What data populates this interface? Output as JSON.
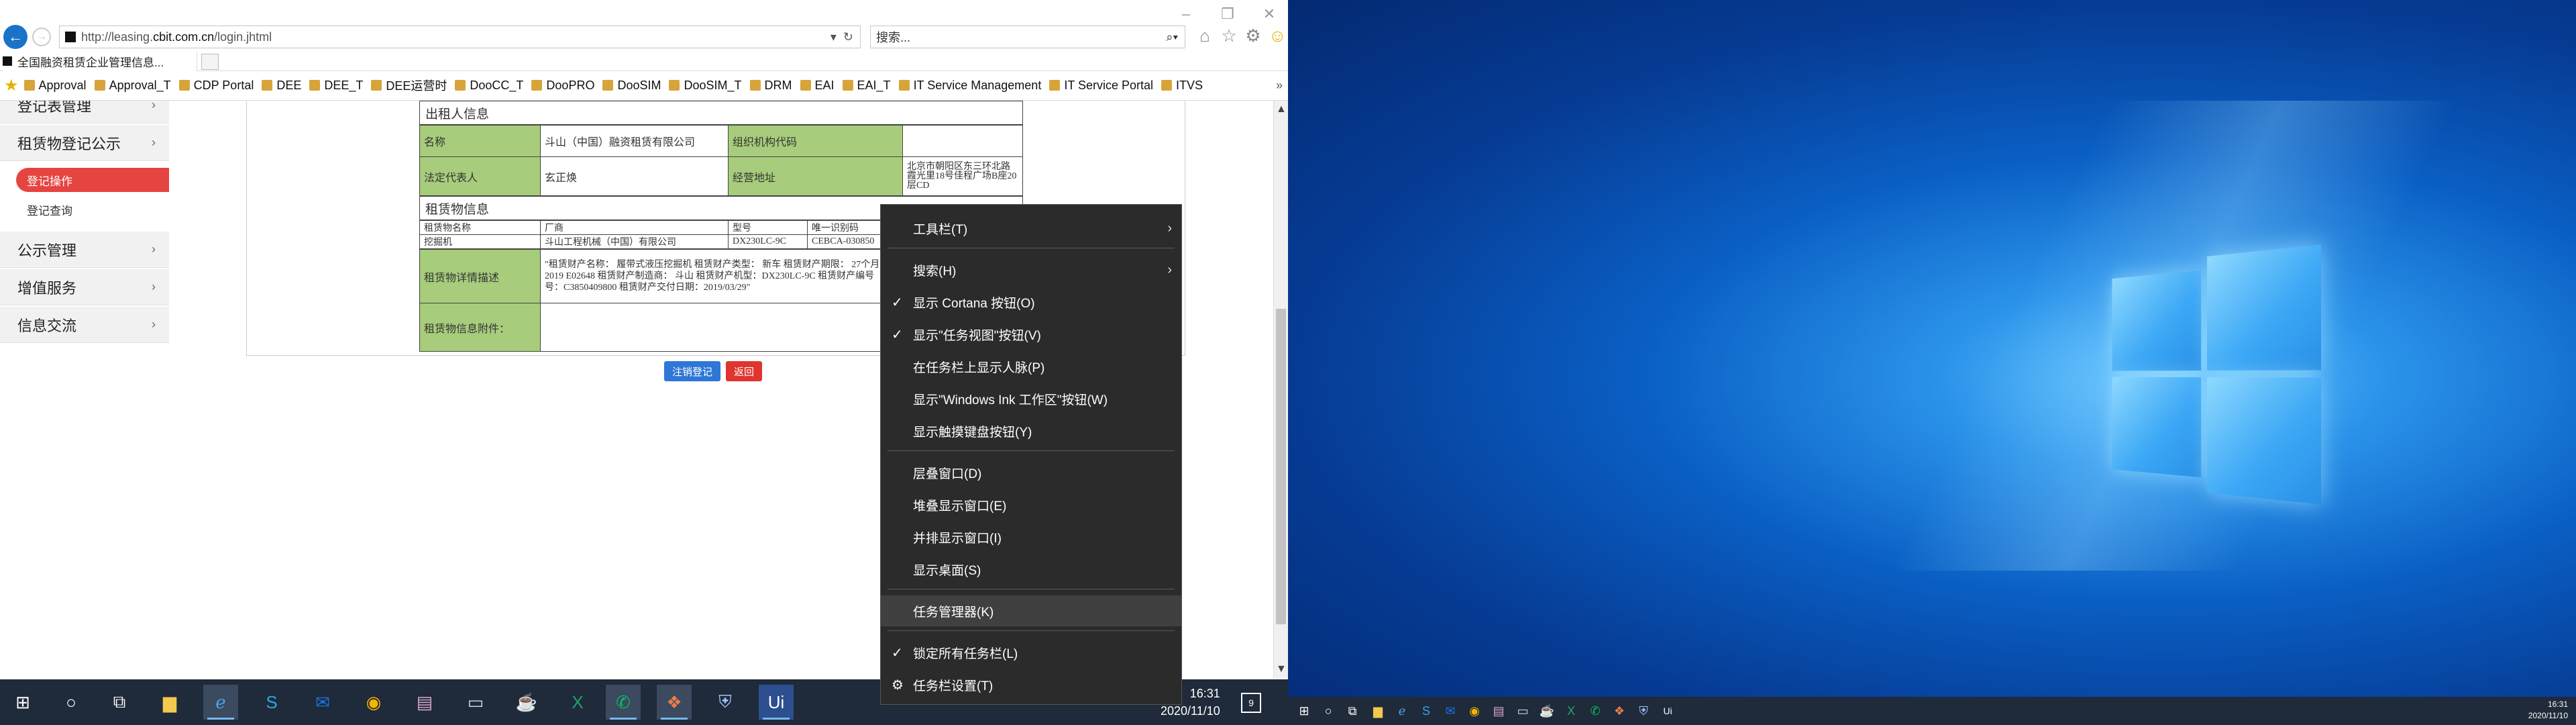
{
  "browser": {
    "address_url_prefix": "http://leasing.",
    "address_url_domain": "cbit.com.cn",
    "address_url_suffix": "/login.jhtml",
    "search_placeholder": "搜索...",
    "tab_title": "全国融资租赁企业管理信息...",
    "favorites": [
      "Approval",
      "Approval_T",
      "CDP Portal",
      "DEE",
      "DEE_T",
      "DEE运营时",
      "DooCC_T",
      "DooPRO",
      "DooSIM",
      "DooSIM_T",
      "DRM",
      "EAI",
      "EAI_T",
      "IT Service Management",
      "IT Service Portal",
      "ITVS"
    ]
  },
  "sidebar": {
    "items": [
      {
        "label": "登记表管理"
      },
      {
        "label": "租赁物登记公示"
      },
      {
        "label": "公示管理"
      },
      {
        "label": "增值服务"
      },
      {
        "label": "信息交流"
      }
    ],
    "subitems": [
      {
        "label": "登记操作"
      },
      {
        "label": "登记查询"
      }
    ]
  },
  "form": {
    "lessor_section_title": "出租人信息",
    "lessor": {
      "name_label": "名称",
      "name_value": "斗山（中国）融资租赁有限公司",
      "org_code_label": "组织机构代码",
      "org_code_value": "",
      "legal_rep_label": "法定代表人",
      "legal_rep_value": "玄正焕",
      "address_label": "经营地址",
      "address_value": "北京市朝阳区东三环北路霞光里18号佳程广场B座20层CD"
    },
    "asset_section_title": "租赁物信息",
    "asset_headers": [
      "租赁物名称",
      "厂商",
      "型号",
      "唯一识别码"
    ],
    "asset_row": [
      "挖掘机",
      "斗山工程机械（中国）有限公司",
      "DX230LC-9C",
      "CEBCA-030850"
    ],
    "detail_label": "租赁物详情描述",
    "detail_value": "\"租赁财产名称： 履带式液压挖掘机 租赁财产类型： 新车 租赁财产期限： 27个月 租赁财产合格证序号：DSCC 2019 E02648 租赁财产制造商： 斗山 租赁财产机型：DX230LC-9C 租赁财产编号（机号）：030850 租赁财产发动机号：C3850409800 租赁财产交付日期：2019/03/29\"",
    "attach_label": "租赁物信息附件：",
    "attach_value": ""
  },
  "buttons": {
    "cancel_registration": "注销登记",
    "back": "返回"
  },
  "context_menu": {
    "items": [
      {
        "label": "工具栏(T)",
        "checked": false,
        "submenu": true
      },
      {
        "label": "搜索(H)",
        "checked": false,
        "submenu": true
      },
      {
        "label": "显示 Cortana 按钮(O)",
        "checked": true,
        "submenu": false
      },
      {
        "label": "显示\"任务视图\"按钮(V)",
        "checked": true,
        "submenu": false
      },
      {
        "label": "在任务栏上显示人脉(P)",
        "checked": false,
        "submenu": false
      },
      {
        "label": "显示\"Windows Ink 工作区\"按钮(W)",
        "checked": false,
        "submenu": false
      },
      {
        "label": "显示触摸键盘按钮(Y)",
        "checked": false,
        "submenu": false
      },
      {
        "label": "层叠窗口(D)",
        "checked": false,
        "submenu": false
      },
      {
        "label": "堆叠显示窗口(E)",
        "checked": false,
        "submenu": false
      },
      {
        "label": "并排显示窗口(I)",
        "checked": false,
        "submenu": false
      },
      {
        "label": "显示桌面(S)",
        "checked": false,
        "submenu": false
      },
      {
        "label": "任务管理器(K)",
        "checked": false,
        "submenu": false
      },
      {
        "label": "锁定所有任务栏(L)",
        "checked": true,
        "submenu": false
      },
      {
        "label": "任务栏设置(T)",
        "checked": false,
        "submenu": false
      }
    ]
  },
  "taskbar1": {
    "time": "16:31",
    "date": "2020/11/10",
    "notification_count": "9"
  },
  "taskbar2": {
    "time": "16:31",
    "date": "2020/11/10"
  },
  "colors": {
    "sidebar_active": "#e64440",
    "form_label_bg": "#a7cc7c",
    "menu_bg": "#2b2b2b",
    "taskbar_bg": "#1f2a3a",
    "ie_back": "#1a73c9"
  }
}
